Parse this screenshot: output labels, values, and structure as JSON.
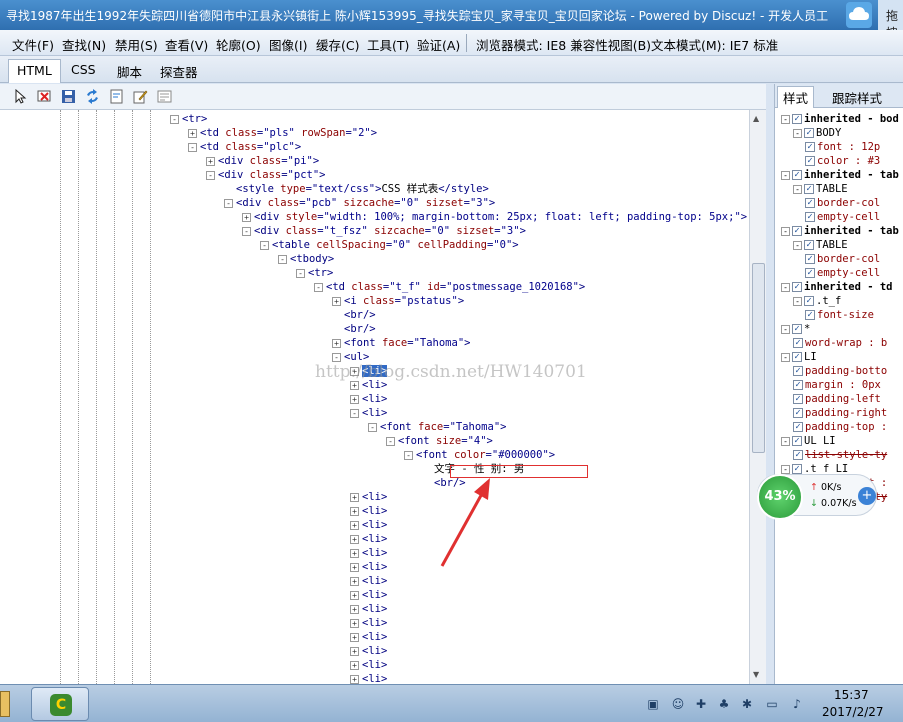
{
  "window": {
    "title": "寻找1987年出生1992年失踪四川省德阳市中江县永兴镇街上 陈小辉153995_寻找失踪宝贝_家寻宝贝_宝贝回家论坛 - Powered by Discuz! - 开发人员工",
    "right_fragment": "拖拽"
  },
  "menu": {
    "items": [
      "文件(F)",
      "查找(N)",
      "禁用(S)",
      "查看(V)",
      "轮廓(O)",
      "图像(I)",
      "缓存(C)",
      "工具(T)",
      "验证(A)"
    ],
    "browser_mode": "浏览器模式: IE8 兼容性视图(B)",
    "doc_mode": "文本模式(M): IE7 标准"
  },
  "tabs": [
    "HTML",
    "CSS",
    "脚本",
    "探查器"
  ],
  "toolbar_icons": [
    "select-element-icon",
    "clear-outline-icon",
    "save-icon",
    "refresh-icon",
    "word-wrap-icon",
    "edit-icon",
    "dom-page-icon"
  ],
  "tree": [
    {
      "indent": 0,
      "exp": "-",
      "parts": [
        [
          "tg",
          "<tr>"
        ]
      ]
    },
    {
      "indent": 1,
      "exp": "+",
      "parts": [
        [
          "tg",
          "<td "
        ],
        [
          "an",
          "class"
        ],
        [
          "tg",
          "="
        ],
        [
          "av",
          "\"pls\""
        ],
        [
          "tg",
          " "
        ],
        [
          "an",
          "rowSpan"
        ],
        [
          "tg",
          "="
        ],
        [
          "av",
          "\"2\""
        ],
        [
          "tg",
          ">"
        ]
      ]
    },
    {
      "indent": 1,
      "exp": "-",
      "parts": [
        [
          "tg",
          "<td "
        ],
        [
          "an",
          "class"
        ],
        [
          "tg",
          "="
        ],
        [
          "av",
          "\"plc\""
        ],
        [
          "tg",
          ">"
        ]
      ]
    },
    {
      "indent": 2,
      "exp": "+",
      "parts": [
        [
          "tg",
          "<div "
        ],
        [
          "an",
          "class"
        ],
        [
          "tg",
          "="
        ],
        [
          "av",
          "\"pi\""
        ],
        [
          "tg",
          ">"
        ]
      ]
    },
    {
      "indent": 2,
      "exp": "-",
      "parts": [
        [
          "tg",
          "<div "
        ],
        [
          "an",
          "class"
        ],
        [
          "tg",
          "="
        ],
        [
          "av",
          "\"pct\""
        ],
        [
          "tg",
          ">"
        ]
      ]
    },
    {
      "indent": 3,
      "exp": "",
      "parts": [
        [
          "tg",
          "<style "
        ],
        [
          "an",
          "type"
        ],
        [
          "tg",
          "="
        ],
        [
          "av",
          "\"text/css\""
        ],
        [
          "tg",
          ">"
        ],
        [
          "tx",
          "CSS 样式表"
        ],
        [
          "tg",
          "</style>"
        ]
      ]
    },
    {
      "indent": 3,
      "exp": "-",
      "parts": [
        [
          "tg",
          "<div "
        ],
        [
          "an",
          "class"
        ],
        [
          "tg",
          "="
        ],
        [
          "av",
          "\"pcb\""
        ],
        [
          "tg",
          " "
        ],
        [
          "an",
          "sizcache"
        ],
        [
          "tg",
          "="
        ],
        [
          "av",
          "\"0\""
        ],
        [
          "tg",
          " "
        ],
        [
          "an",
          "sizset"
        ],
        [
          "tg",
          "="
        ],
        [
          "av",
          "\"3\""
        ],
        [
          "tg",
          ">"
        ]
      ]
    },
    {
      "indent": 4,
      "exp": "+",
      "parts": [
        [
          "tg",
          "<div "
        ],
        [
          "an",
          "style"
        ],
        [
          "tg",
          "="
        ],
        [
          "av",
          "\"width: 100%; margin-bottom: 25px; float: left; padding-top: 5px;\""
        ],
        [
          "tg",
          ">"
        ]
      ]
    },
    {
      "indent": 4,
      "exp": "-",
      "parts": [
        [
          "tg",
          "<div "
        ],
        [
          "an",
          "class"
        ],
        [
          "tg",
          "="
        ],
        [
          "av",
          "\"t_fsz\""
        ],
        [
          "tg",
          " "
        ],
        [
          "an",
          "sizcache"
        ],
        [
          "tg",
          "="
        ],
        [
          "av",
          "\"0\""
        ],
        [
          "tg",
          " "
        ],
        [
          "an",
          "sizset"
        ],
        [
          "tg",
          "="
        ],
        [
          "av",
          "\"3\""
        ],
        [
          "tg",
          ">"
        ]
      ]
    },
    {
      "indent": 5,
      "exp": "-",
      "parts": [
        [
          "tg",
          "<table "
        ],
        [
          "an",
          "cellSpacing"
        ],
        [
          "tg",
          "="
        ],
        [
          "av",
          "\"0\""
        ],
        [
          "tg",
          " "
        ],
        [
          "an",
          "cellPadding"
        ],
        [
          "tg",
          "="
        ],
        [
          "av",
          "\"0\""
        ],
        [
          "tg",
          ">"
        ]
      ]
    },
    {
      "indent": 6,
      "exp": "-",
      "parts": [
        [
          "tg",
          "<tbody>"
        ]
      ]
    },
    {
      "indent": 7,
      "exp": "-",
      "parts": [
        [
          "tg",
          "<tr>"
        ]
      ]
    },
    {
      "indent": 8,
      "exp": "-",
      "parts": [
        [
          "tg",
          "<td "
        ],
        [
          "an",
          "class"
        ],
        [
          "tg",
          "="
        ],
        [
          "av",
          "\"t_f\""
        ],
        [
          "tg",
          " "
        ],
        [
          "an",
          "id"
        ],
        [
          "tg",
          "="
        ],
        [
          "av",
          "\"postmessage_1020168\""
        ],
        [
          "tg",
          ">"
        ]
      ]
    },
    {
      "indent": 9,
      "exp": "+",
      "parts": [
        [
          "tg",
          "<i "
        ],
        [
          "an",
          "class"
        ],
        [
          "tg",
          "="
        ],
        [
          "av",
          "\"pstatus\""
        ],
        [
          "tg",
          ">"
        ]
      ]
    },
    {
      "indent": 9,
      "exp": "",
      "parts": [
        [
          "tg",
          "<br/>"
        ]
      ]
    },
    {
      "indent": 9,
      "exp": "",
      "parts": [
        [
          "tg",
          "<br/>"
        ]
      ]
    },
    {
      "indent": 9,
      "exp": "+",
      "parts": [
        [
          "tg",
          "<font "
        ],
        [
          "an",
          "face"
        ],
        [
          "tg",
          "="
        ],
        [
          "av",
          "\"Tahoma\""
        ],
        [
          "tg",
          ">"
        ]
      ]
    },
    {
      "indent": 9,
      "exp": "-",
      "parts": [
        [
          "tg",
          "<ul>"
        ]
      ]
    },
    {
      "indent": 10,
      "exp": "+",
      "sel": true,
      "parts": [
        [
          "tg",
          "<li>"
        ]
      ]
    },
    {
      "indent": 10,
      "exp": "+",
      "parts": [
        [
          "tg",
          "<li>"
        ]
      ]
    },
    {
      "indent": 10,
      "exp": "+",
      "parts": [
        [
          "tg",
          "<li>"
        ]
      ]
    },
    {
      "indent": 10,
      "exp": "-",
      "parts": [
        [
          "tg",
          "<li>"
        ]
      ]
    },
    {
      "indent": 11,
      "exp": "-",
      "parts": [
        [
          "tg",
          "<font "
        ],
        [
          "an",
          "face"
        ],
        [
          "tg",
          "="
        ],
        [
          "av",
          "\"Tahoma\""
        ],
        [
          "tg",
          ">"
        ]
      ]
    },
    {
      "indent": 12,
      "exp": "-",
      "parts": [
        [
          "tg",
          "<font "
        ],
        [
          "an",
          "size"
        ],
        [
          "tg",
          "="
        ],
        [
          "av",
          "\"4\""
        ],
        [
          "tg",
          ">"
        ]
      ]
    },
    {
      "indent": 13,
      "exp": "-",
      "parts": [
        [
          "tg",
          "<font "
        ],
        [
          "an",
          "color"
        ],
        [
          "tg",
          "="
        ],
        [
          "av",
          "\"#000000\""
        ],
        [
          "tg",
          ">"
        ]
      ]
    },
    {
      "indent": 14,
      "exp": "",
      "parts": [
        [
          "tx",
          "文字 - 性      别: 男"
        ]
      ]
    },
    {
      "indent": 14,
      "exp": "",
      "parts": [
        [
          "tg",
          "<br/>"
        ]
      ]
    },
    {
      "indent": 10,
      "exp": "+",
      "parts": [
        [
          "tg",
          "<li>"
        ]
      ]
    },
    {
      "indent": 10,
      "exp": "+",
      "parts": [
        [
          "tg",
          "<li>"
        ]
      ]
    },
    {
      "indent": 10,
      "exp": "+",
      "parts": [
        [
          "tg",
          "<li>"
        ]
      ]
    },
    {
      "indent": 10,
      "exp": "+",
      "parts": [
        [
          "tg",
          "<li>"
        ]
      ]
    },
    {
      "indent": 10,
      "exp": "+",
      "parts": [
        [
          "tg",
          "<li>"
        ]
      ]
    },
    {
      "indent": 10,
      "exp": "+",
      "parts": [
        [
          "tg",
          "<li>"
        ]
      ]
    },
    {
      "indent": 10,
      "exp": "+",
      "parts": [
        [
          "tg",
          "<li>"
        ]
      ]
    },
    {
      "indent": 10,
      "exp": "+",
      "parts": [
        [
          "tg",
          "<li>"
        ]
      ]
    },
    {
      "indent": 10,
      "exp": "+",
      "parts": [
        [
          "tg",
          "<li>"
        ]
      ]
    },
    {
      "indent": 10,
      "exp": "+",
      "parts": [
        [
          "tg",
          "<li>"
        ]
      ]
    },
    {
      "indent": 10,
      "exp": "+",
      "parts": [
        [
          "tg",
          "<li>"
        ]
      ]
    },
    {
      "indent": 10,
      "exp": "+",
      "parts": [
        [
          "tg",
          "<li>"
        ]
      ]
    },
    {
      "indent": 10,
      "exp": "+",
      "parts": [
        [
          "tg",
          "<li>"
        ]
      ]
    },
    {
      "indent": 10,
      "exp": "+",
      "parts": [
        [
          "tg",
          "<li>"
        ]
      ]
    },
    {
      "indent": 10,
      "exp": "+",
      "parts": [
        [
          "tg",
          "<li>"
        ]
      ]
    }
  ],
  "watermark": "http://blog.csdn.net/HW140701",
  "right_tabs": [
    "样式",
    "跟踪样式"
  ],
  "styles": [
    {
      "indent": 0,
      "exp": "-",
      "cb": true,
      "cls": "b",
      "text": "inherited - bod"
    },
    {
      "indent": 1,
      "exp": "-",
      "cb": true,
      "cls": "",
      "text": "BODY"
    },
    {
      "indent": 2,
      "exp": "",
      "cb": true,
      "cls": "prop",
      "text": "font : 12p"
    },
    {
      "indent": 2,
      "exp": "",
      "cb": true,
      "cls": "prop",
      "text": "color : #3"
    },
    {
      "indent": 0,
      "exp": "-",
      "cb": true,
      "cls": "b",
      "text": "inherited - tab"
    },
    {
      "indent": 1,
      "exp": "-",
      "cb": true,
      "cls": "",
      "text": "TABLE"
    },
    {
      "indent": 2,
      "exp": "",
      "cb": true,
      "cls": "prop",
      "text": "border-col"
    },
    {
      "indent": 2,
      "exp": "",
      "cb": true,
      "cls": "prop",
      "text": "empty-cell"
    },
    {
      "indent": 0,
      "exp": "-",
      "cb": true,
      "cls": "b",
      "text": "inherited - tab"
    },
    {
      "indent": 1,
      "exp": "-",
      "cb": true,
      "cls": "",
      "text": "TABLE"
    },
    {
      "indent": 2,
      "exp": "",
      "cb": true,
      "cls": "prop",
      "text": "border-col"
    },
    {
      "indent": 2,
      "exp": "",
      "cb": true,
      "cls": "prop",
      "text": "empty-cell"
    },
    {
      "indent": 0,
      "exp": "-",
      "cb": true,
      "cls": "b",
      "text": "inherited - td"
    },
    {
      "indent": 1,
      "exp": "-",
      "cb": true,
      "cls": "",
      "text": ".t_f"
    },
    {
      "indent": 2,
      "exp": "",
      "cb": true,
      "cls": "prop",
      "text": "font-size"
    },
    {
      "indent": 0,
      "exp": "-",
      "cb": true,
      "cls": "",
      "text": "*"
    },
    {
      "indent": 1,
      "exp": "",
      "cb": true,
      "cls": "prop",
      "text": "word-wrap : b"
    },
    {
      "indent": 0,
      "exp": "-",
      "cb": true,
      "cls": "",
      "text": "LI"
    },
    {
      "indent": 1,
      "exp": "",
      "cb": true,
      "cls": "prop",
      "text": "padding-botto"
    },
    {
      "indent": 1,
      "exp": "",
      "cb": true,
      "cls": "prop",
      "text": "margin : 0px"
    },
    {
      "indent": 1,
      "exp": "",
      "cb": true,
      "cls": "prop",
      "text": "padding-left"
    },
    {
      "indent": 1,
      "exp": "",
      "cb": true,
      "cls": "prop",
      "text": "padding-right"
    },
    {
      "indent": 1,
      "exp": "",
      "cb": true,
      "cls": "prop",
      "text": "padding-top :"
    },
    {
      "indent": 0,
      "exp": "-",
      "cb": true,
      "cls": "",
      "text": "UL LI"
    },
    {
      "indent": 1,
      "exp": "",
      "cb": true,
      "cls": "prop strike",
      "text": "list-style-ty"
    },
    {
      "indent": 0,
      "exp": "-",
      "cb": true,
      "cls": "",
      "text": ".t_f LI"
    },
    {
      "indent": 1,
      "exp": "",
      "cb": true,
      "cls": "prop",
      "text": "margin-left :"
    },
    {
      "indent": 1,
      "exp": "",
      "cb": true,
      "cls": "prop strike",
      "text": "list-style-ty"
    }
  ],
  "net_widget": {
    "percent": "43%",
    "up": "0K/s",
    "down": "0.07K/s"
  },
  "taskbar": {
    "time": "15:37",
    "date": "2017/2/27"
  },
  "colors": {
    "accent": "#316ac5",
    "annotation_red": "#e03030",
    "tag": "#000080",
    "attr_name": "#8b0000",
    "attr_value": "#00008b"
  }
}
